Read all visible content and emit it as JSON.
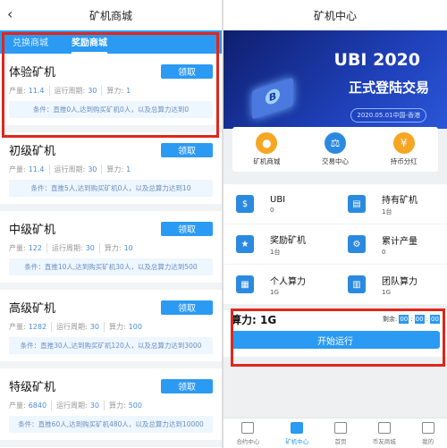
{
  "left": {
    "title": "矿机商城",
    "tabs": [
      {
        "label": "兑换商城",
        "active": false
      },
      {
        "label": "奖励商城",
        "active": true
      }
    ],
    "stat_labels": {
      "output": "产量:",
      "period": "运行周期:",
      "power": "算力:"
    },
    "action_label": "领取",
    "cards": [
      {
        "name": "体验矿机",
        "output": "11.4",
        "period": "30",
        "power": "1",
        "condition": "条件：直推0人,达到购买矿机0人，以及总算力达到0"
      },
      {
        "name": "初级矿机",
        "output": "11.4",
        "period": "30",
        "power": "1",
        "condition": "条件：直推5人,达到购买矿机0人，以及总算力达到10"
      },
      {
        "name": "中级矿机",
        "output": "122",
        "period": "30",
        "power": "10",
        "condition": "条件：直推10人,达到购买矿机30人，以及总算力达到500"
      },
      {
        "name": "高级矿机",
        "output": "1282",
        "period": "30",
        "power": "100",
        "condition": "条件：直推30人,达到购买矿机120人，以及总算力达到3000"
      },
      {
        "name": "特级矿机",
        "output": "6840",
        "period": "30",
        "power": "500",
        "condition": "条件：直推60人,达到购买矿机480人，以及总算力达到10000"
      }
    ]
  },
  "right": {
    "title": "矿机中心",
    "banner": {
      "title": "UBI 2020",
      "subtitle": "正式登陆交易",
      "date": "2020.05.01中国-香港",
      "coin_symbol": "B"
    },
    "shortcuts": [
      {
        "label": "矿机商城",
        "icon": "coins-icon",
        "color": "#f5a623"
      },
      {
        "label": "交易中心",
        "icon": "scale-icon",
        "color": "#2b8ae0"
      },
      {
        "label": "持币分红",
        "icon": "money-bag-icon",
        "color": "#f5a623"
      }
    ],
    "stats": [
      {
        "title": "UBI",
        "value": "0",
        "icon": "wallet-icon"
      },
      {
        "title": "持有矿机",
        "value": "1台",
        "icon": "machine-icon"
      },
      {
        "title": "奖励矿机",
        "value": "1台",
        "icon": "medal-icon"
      },
      {
        "title": "累计产量",
        "value": "0",
        "icon": "gears-icon"
      },
      {
        "title": "个人算力",
        "value": "1G",
        "icon": "grid-icon"
      },
      {
        "title": "团队算力",
        "value": "1G",
        "icon": "calculator-icon"
      }
    ],
    "power": {
      "label": "算力: 1G",
      "remain_label": "剩余:",
      "h": "00",
      "m": "00",
      "s": "00"
    },
    "start_label": "开始运行",
    "nav": [
      {
        "label": "合约中心",
        "active": false
      },
      {
        "label": "矿机中心",
        "active": true
      },
      {
        "label": "首页",
        "active": false
      },
      {
        "label": "币友商城",
        "active": false
      },
      {
        "label": "我的",
        "active": false
      }
    ]
  },
  "colors": {
    "primary": "#2b9af3",
    "highlight": "#e0261b"
  }
}
